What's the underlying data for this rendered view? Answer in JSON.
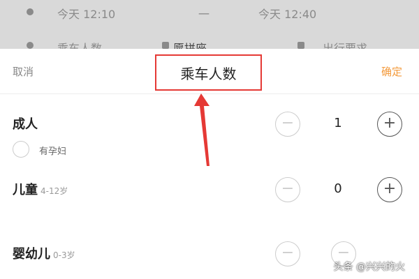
{
  "backdrop": {
    "start_time": "今天 12:10",
    "separator": "一",
    "end_time": "今天 12:40",
    "passenger_count_label": "乘车人数",
    "carpool_label": "愿拼座",
    "travel_requirement_label": "出行要求"
  },
  "sheet": {
    "cancel_label": "取消",
    "title": "乘车人数",
    "confirm_label": "确定",
    "accent_color": "#f39a3c",
    "highlight_color": "#e53935"
  },
  "passengers": {
    "adult": {
      "label": "成人",
      "count": "1",
      "pregnant_label": "有孕妇"
    },
    "child": {
      "label": "儿童",
      "age_range": "4-12岁",
      "count": "0"
    },
    "infant": {
      "label": "婴幼儿",
      "age_range": "0-3岁"
    }
  },
  "controls": {
    "minus": "−",
    "plus": "+"
  },
  "watermark": "头条 @兴兴的火"
}
